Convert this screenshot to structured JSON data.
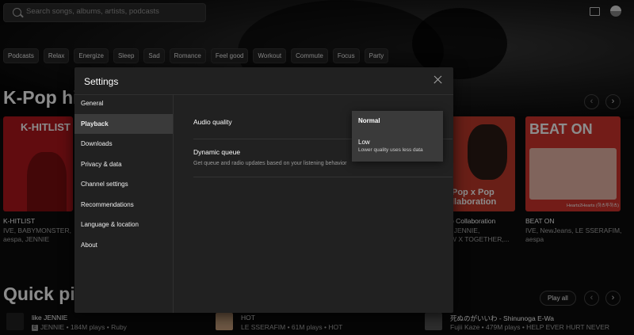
{
  "search": {
    "placeholder": "Search songs, albums, artists, podcasts"
  },
  "chips": [
    "Podcasts",
    "Relax",
    "Energize",
    "Sleep",
    "Sad",
    "Romance",
    "Feel good",
    "Workout",
    "Commute",
    "Focus",
    "Party"
  ],
  "shelf": {
    "title": "K-Pop hi",
    "cards": [
      {
        "art_text": "K-HITLIST",
        "title": "K-HITLIST",
        "sub": "IVE, BABYMONSTER, aespa, JENNIE",
        "color": "#b1171d"
      },
      {
        "art_text": "Pop x Pop\nllaboration",
        "title": "p Collaboration",
        "sub": ", JENNIE,\nW X TOGETHER,...",
        "color": "#c0392b"
      },
      {
        "art_text": "BEAT ON",
        "caption": "Hearts2Hearts (하츠투하츠)",
        "title": "BEAT ON",
        "sub": "IVE, NewJeans, LE SSERAFIM, aespa",
        "color": "#d2342c"
      }
    ]
  },
  "quick": {
    "title": "Quick pic",
    "play_all": "Play all",
    "rows": [
      {
        "title": "like JENNIE",
        "sub": "JENNIE • 184M plays • Ruby",
        "explicit": true
      },
      {
        "title": "HOT",
        "sub": "LE SSERAFIM • 61M plays • HOT",
        "explicit": false
      },
      {
        "title": "死ぬのがいいわ - Shinunoga E-Wa",
        "sub": "Fujii Kaze • 479M plays • HELP EVER HURT NEVER",
        "explicit": false
      }
    ]
  },
  "settings": {
    "title": "Settings",
    "nav": [
      "General",
      "Playback",
      "Downloads",
      "Privacy & data",
      "Channel settings",
      "Recommendations",
      "Language & location",
      "About"
    ],
    "active": "Playback",
    "options": [
      {
        "label": "Audio quality"
      },
      {
        "label": "Dynamic queue",
        "desc": "Get queue and radio updates based on your listening behavior"
      }
    ],
    "dropdown": [
      {
        "label": "Normal",
        "selected": true
      },
      {
        "label": "Low",
        "desc": "Lower quality uses less data"
      }
    ]
  },
  "icons": {
    "search": "search-icon",
    "cast": "cast-icon",
    "close": "close-icon",
    "prev": "chevron-left-icon",
    "next": "chevron-right-icon"
  }
}
